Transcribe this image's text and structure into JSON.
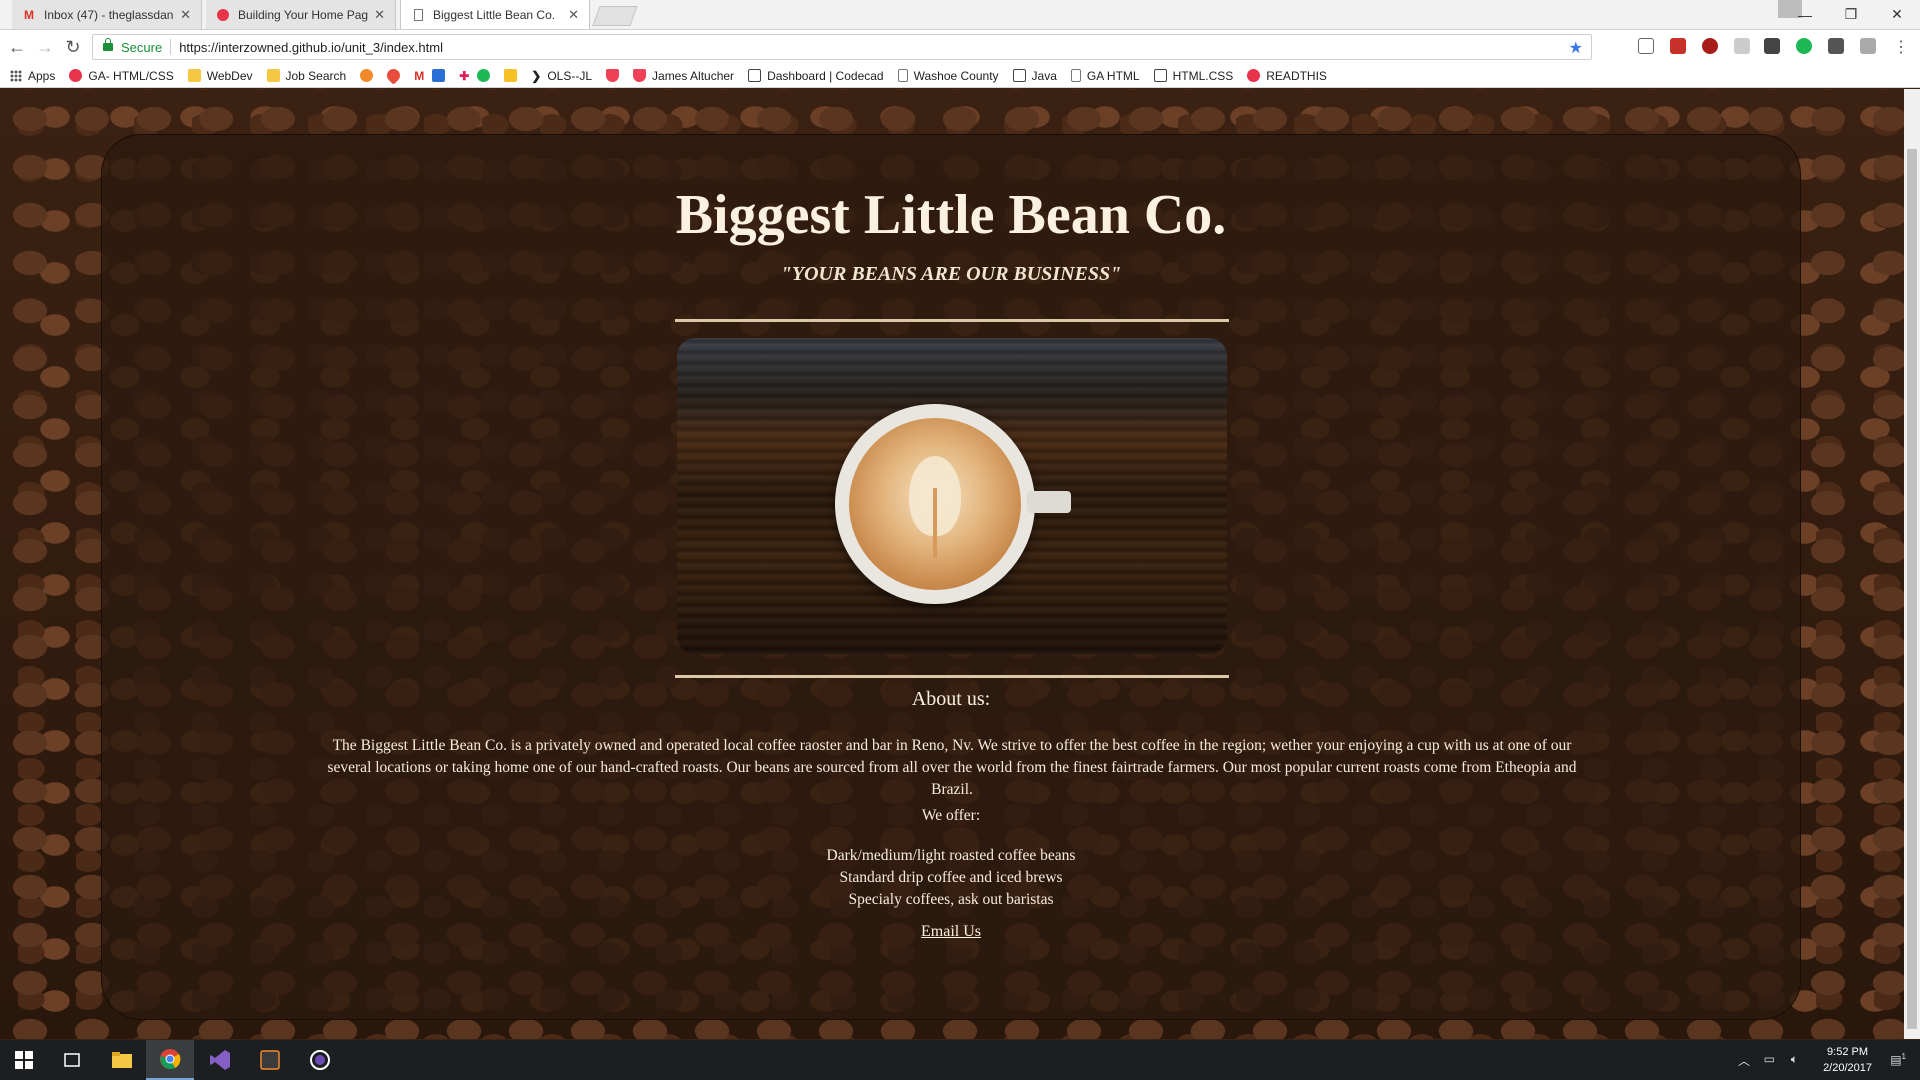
{
  "browser": {
    "tabs": [
      {
        "title": "Inbox (47) - theglassdan",
        "icon": "gmail-icon",
        "icon_color": "#d93025"
      },
      {
        "title": "Building Your Home Pag",
        "icon": "ga-icon",
        "icon_color": "#e8334a"
      },
      {
        "title": "Biggest Little Bean Co.",
        "icon": "page-icon",
        "icon_color": "#777777"
      }
    ],
    "secure_label": "Secure",
    "url": "https://interzowned.github.io/unit_3/index.html"
  },
  "bookmarks": [
    {
      "label": "Apps",
      "icon": "apps-grid-icon"
    },
    {
      "label": "GA- HTML/CSS",
      "icon": "ga-icon",
      "color": "#e8334a"
    },
    {
      "label": "WebDev",
      "icon": "folder-icon",
      "color": "#f4c842"
    },
    {
      "label": "Job Search",
      "icon": "folder-icon",
      "color": "#f4c842"
    },
    {
      "label": "",
      "icon": "orange-dot-icon",
      "color": "#f28a2a"
    },
    {
      "label": "",
      "icon": "heart-icon",
      "color": "#e74c3c"
    },
    {
      "label": "",
      "icon": "gmail-icon",
      "color": "#d93025"
    },
    {
      "label": "",
      "icon": "mail-icon",
      "color": "#2a6fd6"
    },
    {
      "label": "",
      "icon": "slack-icon",
      "color": "#e01e5a"
    },
    {
      "label": "",
      "icon": "spotify-icon",
      "color": "#1db954"
    },
    {
      "label": "",
      "icon": "keep-icon",
      "color": "#f6c026"
    },
    {
      "label": "OLS--JL",
      "icon": "bookmark-icon",
      "color": "#222222"
    },
    {
      "label": "",
      "icon": "pocket-icon",
      "color": "#ef4056"
    },
    {
      "label": "James Altucher",
      "icon": "pocket-icon",
      "color": "#ef4056"
    },
    {
      "label": "Dashboard | Codecad",
      "icon": "codecademy-icon",
      "color": "#444444"
    },
    {
      "label": "Washoe County",
      "icon": "page-icon",
      "color": "#777777"
    },
    {
      "label": "Java",
      "icon": "codecademy-icon",
      "color": "#444444"
    },
    {
      "label": "GA HTML",
      "icon": "page-icon",
      "color": "#777777"
    },
    {
      "label": "HTML.CSS",
      "icon": "codecademy-icon",
      "color": "#444444"
    },
    {
      "label": "READTHIS",
      "icon": "ga-icon",
      "color": "#e8334a"
    }
  ],
  "page": {
    "title": "Biggest Little Bean Co.",
    "tagline": "\"YOUR BEANS ARE OUR BUSINESS\"",
    "about_heading": "About us:",
    "about_text": "The Biggest Little Bean Co. is a privately owned and operated local coffee raoster and bar in Reno, Nv. We strive to offer the best coffee in the region; wether your enjoying a cup with us at one of our several locations or taking home one of our hand-crafted roasts. Our beans are sourced from all over the world from the finest fairtrade farmers. Our most popular current roasts come from Etheopia and Brazil.",
    "offer_heading": "We offer:",
    "offers": [
      "Dark/medium/light roasted coffee beans",
      "Standard drip coffee and iced brews",
      "Specialy coffees, ask out baristas"
    ],
    "email_label": "Email Us"
  },
  "taskbar": {
    "time": "9:52 PM",
    "date": "2/20/2017",
    "notification_count": "1"
  }
}
